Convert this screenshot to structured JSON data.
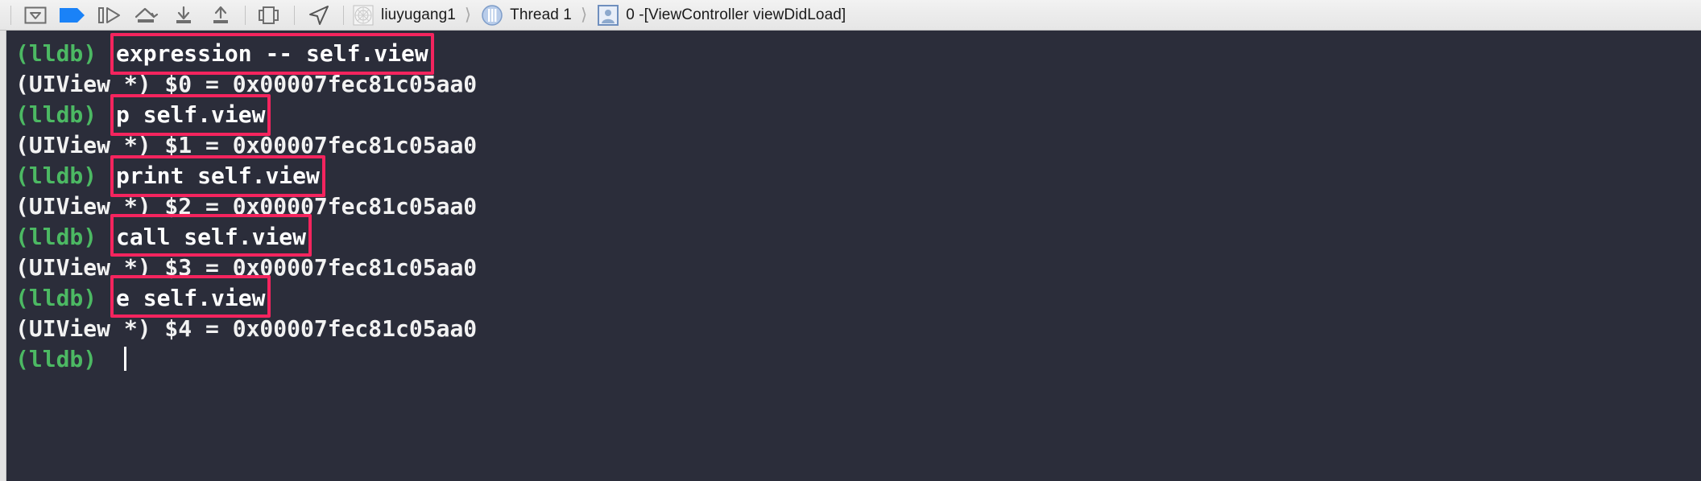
{
  "toolbar": {
    "buttons": [
      {
        "name": "hide-debug-area-button",
        "icon": "panel-toggle-icon",
        "title": "Hide Debug Area"
      },
      {
        "name": "continue-button",
        "icon": "continue-flag-icon",
        "title": "Continue program execution"
      },
      {
        "name": "step-over-button",
        "icon": "step-over-icon",
        "title": "Step over"
      },
      {
        "name": "step-over-instruction-button",
        "icon": "step-over-arc-icon",
        "title": "Step over instruction"
      },
      {
        "name": "step-into-button",
        "icon": "step-into-icon",
        "title": "Step into"
      },
      {
        "name": "step-out-button",
        "icon": "step-out-icon",
        "title": "Step out"
      },
      {
        "name": "debug-view-hierarchy-button",
        "icon": "view-hierarchy-icon",
        "title": "Debug View Hierarchy"
      },
      {
        "name": "simulate-location-button",
        "icon": "location-arrow-icon",
        "title": "Simulate Location"
      }
    ]
  },
  "breadcrumb": [
    {
      "name": "breadcrumb-process",
      "icon": "process-icon",
      "label": "liuyugang1"
    },
    {
      "name": "breadcrumb-thread",
      "icon": "thread-icon",
      "label": "Thread 1"
    },
    {
      "name": "breadcrumb-frame",
      "icon": "stack-frame-icon",
      "label": "0 -[ViewController viewDidLoad]"
    }
  ],
  "console": {
    "prompt": "(lldb)",
    "entries": [
      {
        "command": "expression -- self.view",
        "result": "(UIView *) $0 = 0x00007fec81c05aa0",
        "boxed": true,
        "clipped": false
      },
      {
        "command": "p self.view",
        "result": "(UIView *) $1 = 0x00007fec81c05aa0",
        "boxed": true,
        "clipped": false
      },
      {
        "command": "print self.view",
        "result": "(UIView *) $2 = 0x00007fec81c05aa0",
        "boxed": true,
        "clipped": false
      },
      {
        "command": "call self.view",
        "result": "(UIView *) $3 = 0x00007fec81c05aa0",
        "boxed": true,
        "clipped": true
      },
      {
        "command": "e self.view",
        "result": "(UIView *) $4 = 0x00007fec81c05aa0",
        "boxed": true,
        "clipped": true
      }
    ],
    "cursor_line": "(lldb) "
  },
  "colors": {
    "console_background": "#2b2d3a",
    "prompt_green": "#4cb963",
    "output_text": "#f2f2f2",
    "highlight_box": "#f4245e",
    "toolbar_background": "#ebebeb",
    "continue_blue": "#1a82f7"
  }
}
